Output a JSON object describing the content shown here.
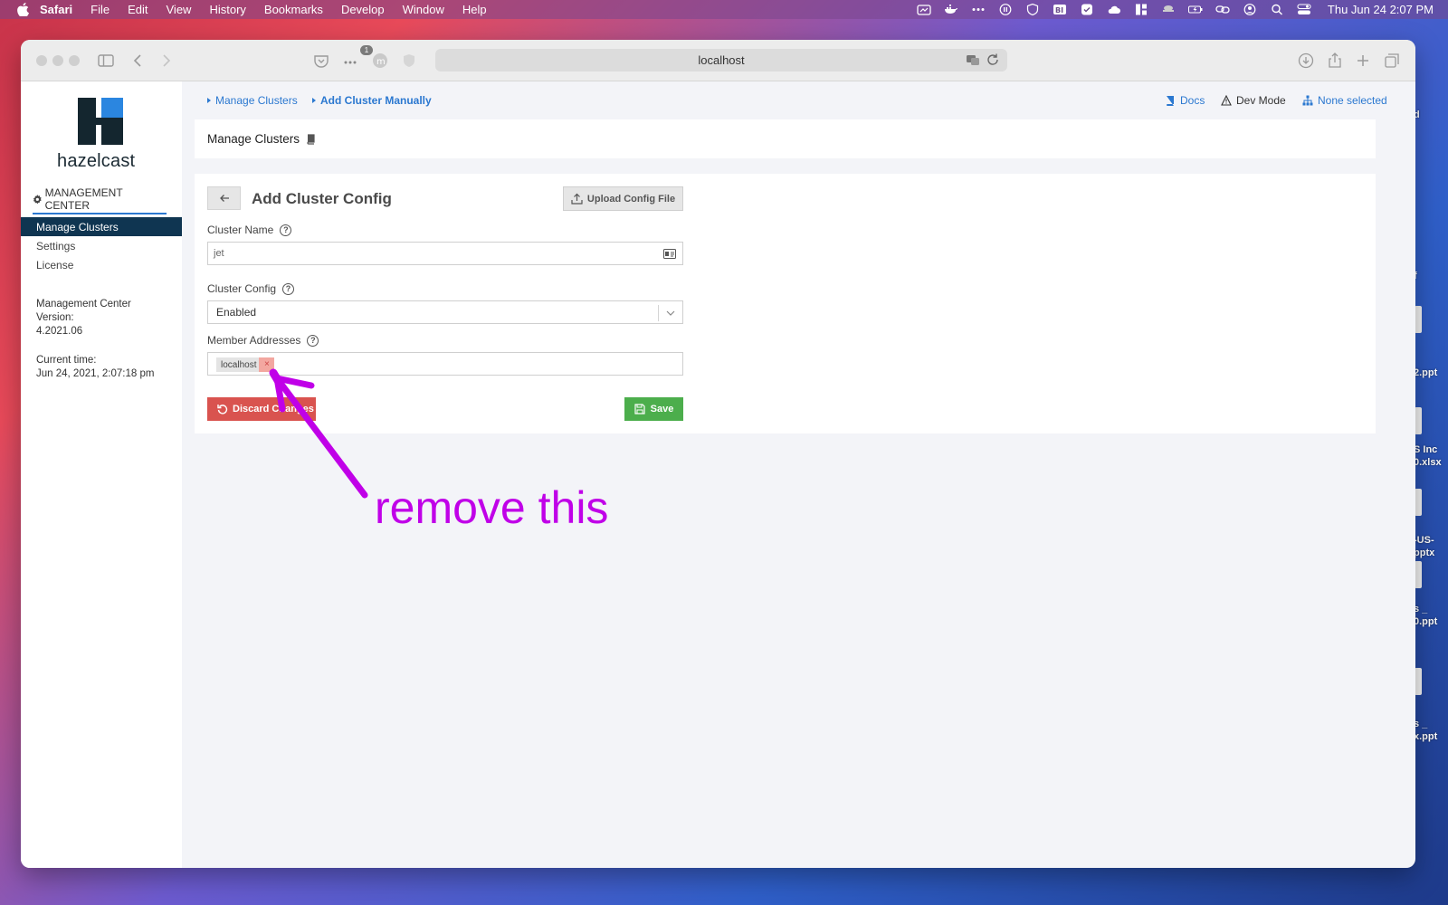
{
  "menubar": {
    "items": [
      "Safari",
      "File",
      "Edit",
      "View",
      "History",
      "Bookmarks",
      "Develop",
      "Window",
      "Help"
    ],
    "clock": "Thu Jun 24  2:07 PM"
  },
  "desktop": {
    "fragments": [
      "d",
      "f",
      "2.ppt",
      "S Inc",
      "0.xlsx",
      "-US-",
      "pptx",
      "s _",
      "0.ppt",
      "s _",
      "x.ppt"
    ]
  },
  "browser": {
    "url": "localhost",
    "badge_count": "1"
  },
  "sidebar": {
    "logo_text": "hazelcast",
    "section_title": "MANAGEMENT CENTER",
    "items": [
      {
        "label": "Manage Clusters",
        "active": true
      },
      {
        "label": "Settings",
        "active": false
      },
      {
        "label": "License",
        "active": false
      }
    ],
    "version_label": "Management Center",
    "version_label2": "Version:",
    "version_value": "4.2021.06",
    "time_label": "Current time:",
    "time_value": "Jun 24, 2021, 2:07:18 pm"
  },
  "topnav": {
    "crumb1": "Manage Clusters",
    "crumb2": "Add Cluster Manually",
    "docs": "Docs",
    "dev_mode": "Dev Mode",
    "none_selected": "None selected"
  },
  "header": {
    "title": "Manage Clusters"
  },
  "form": {
    "title": "Add Cluster Config",
    "upload_label": "Upload Config File",
    "cluster_name_label": "Cluster Name",
    "cluster_name_value": "jet",
    "cluster_config_label": "Cluster Config",
    "cluster_config_value": "Enabled",
    "member_addresses_label": "Member Addresses",
    "member_tag": "localhost",
    "discard_label": "Discard Changes",
    "save_label": "Save"
  },
  "annotation": {
    "text": "remove this",
    "color": "#c000e8"
  },
  "colors": {
    "accent": "#2b78d0",
    "nav_active": "#0f3551",
    "danger": "#d9534f",
    "success": "#4cae4c"
  }
}
